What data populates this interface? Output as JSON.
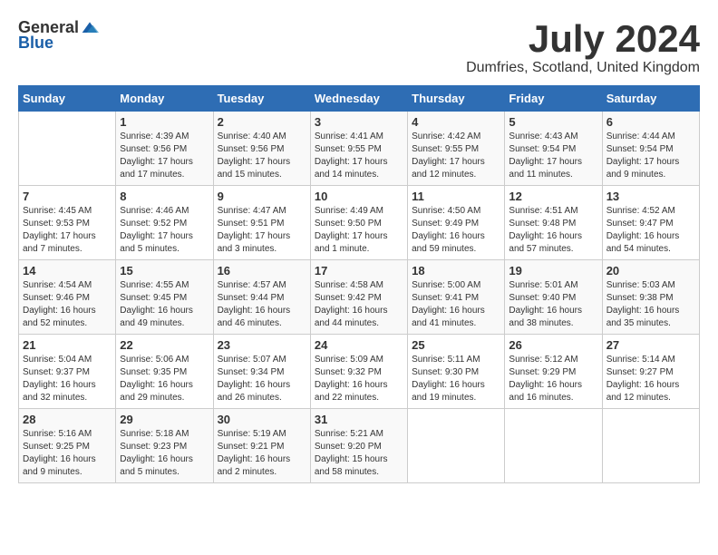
{
  "header": {
    "logo_general": "General",
    "logo_blue": "Blue",
    "title": "July 2024",
    "subtitle": "Dumfries, Scotland, United Kingdom"
  },
  "days_of_week": [
    "Sunday",
    "Monday",
    "Tuesday",
    "Wednesday",
    "Thursday",
    "Friday",
    "Saturday"
  ],
  "weeks": [
    [
      {
        "day": "",
        "info": ""
      },
      {
        "day": "1",
        "info": "Sunrise: 4:39 AM\nSunset: 9:56 PM\nDaylight: 17 hours\nand 17 minutes."
      },
      {
        "day": "2",
        "info": "Sunrise: 4:40 AM\nSunset: 9:56 PM\nDaylight: 17 hours\nand 15 minutes."
      },
      {
        "day": "3",
        "info": "Sunrise: 4:41 AM\nSunset: 9:55 PM\nDaylight: 17 hours\nand 14 minutes."
      },
      {
        "day": "4",
        "info": "Sunrise: 4:42 AM\nSunset: 9:55 PM\nDaylight: 17 hours\nand 12 minutes."
      },
      {
        "day": "5",
        "info": "Sunrise: 4:43 AM\nSunset: 9:54 PM\nDaylight: 17 hours\nand 11 minutes."
      },
      {
        "day": "6",
        "info": "Sunrise: 4:44 AM\nSunset: 9:54 PM\nDaylight: 17 hours\nand 9 minutes."
      }
    ],
    [
      {
        "day": "7",
        "info": "Sunrise: 4:45 AM\nSunset: 9:53 PM\nDaylight: 17 hours\nand 7 minutes."
      },
      {
        "day": "8",
        "info": "Sunrise: 4:46 AM\nSunset: 9:52 PM\nDaylight: 17 hours\nand 5 minutes."
      },
      {
        "day": "9",
        "info": "Sunrise: 4:47 AM\nSunset: 9:51 PM\nDaylight: 17 hours\nand 3 minutes."
      },
      {
        "day": "10",
        "info": "Sunrise: 4:49 AM\nSunset: 9:50 PM\nDaylight: 17 hours\nand 1 minute."
      },
      {
        "day": "11",
        "info": "Sunrise: 4:50 AM\nSunset: 9:49 PM\nDaylight: 16 hours\nand 59 minutes."
      },
      {
        "day": "12",
        "info": "Sunrise: 4:51 AM\nSunset: 9:48 PM\nDaylight: 16 hours\nand 57 minutes."
      },
      {
        "day": "13",
        "info": "Sunrise: 4:52 AM\nSunset: 9:47 PM\nDaylight: 16 hours\nand 54 minutes."
      }
    ],
    [
      {
        "day": "14",
        "info": "Sunrise: 4:54 AM\nSunset: 9:46 PM\nDaylight: 16 hours\nand 52 minutes."
      },
      {
        "day": "15",
        "info": "Sunrise: 4:55 AM\nSunset: 9:45 PM\nDaylight: 16 hours\nand 49 minutes."
      },
      {
        "day": "16",
        "info": "Sunrise: 4:57 AM\nSunset: 9:44 PM\nDaylight: 16 hours\nand 46 minutes."
      },
      {
        "day": "17",
        "info": "Sunrise: 4:58 AM\nSunset: 9:42 PM\nDaylight: 16 hours\nand 44 minutes."
      },
      {
        "day": "18",
        "info": "Sunrise: 5:00 AM\nSunset: 9:41 PM\nDaylight: 16 hours\nand 41 minutes."
      },
      {
        "day": "19",
        "info": "Sunrise: 5:01 AM\nSunset: 9:40 PM\nDaylight: 16 hours\nand 38 minutes."
      },
      {
        "day": "20",
        "info": "Sunrise: 5:03 AM\nSunset: 9:38 PM\nDaylight: 16 hours\nand 35 minutes."
      }
    ],
    [
      {
        "day": "21",
        "info": "Sunrise: 5:04 AM\nSunset: 9:37 PM\nDaylight: 16 hours\nand 32 minutes."
      },
      {
        "day": "22",
        "info": "Sunrise: 5:06 AM\nSunset: 9:35 PM\nDaylight: 16 hours\nand 29 minutes."
      },
      {
        "day": "23",
        "info": "Sunrise: 5:07 AM\nSunset: 9:34 PM\nDaylight: 16 hours\nand 26 minutes."
      },
      {
        "day": "24",
        "info": "Sunrise: 5:09 AM\nSunset: 9:32 PM\nDaylight: 16 hours\nand 22 minutes."
      },
      {
        "day": "25",
        "info": "Sunrise: 5:11 AM\nSunset: 9:30 PM\nDaylight: 16 hours\nand 19 minutes."
      },
      {
        "day": "26",
        "info": "Sunrise: 5:12 AM\nSunset: 9:29 PM\nDaylight: 16 hours\nand 16 minutes."
      },
      {
        "day": "27",
        "info": "Sunrise: 5:14 AM\nSunset: 9:27 PM\nDaylight: 16 hours\nand 12 minutes."
      }
    ],
    [
      {
        "day": "28",
        "info": "Sunrise: 5:16 AM\nSunset: 9:25 PM\nDaylight: 16 hours\nand 9 minutes."
      },
      {
        "day": "29",
        "info": "Sunrise: 5:18 AM\nSunset: 9:23 PM\nDaylight: 16 hours\nand 5 minutes."
      },
      {
        "day": "30",
        "info": "Sunrise: 5:19 AM\nSunset: 9:21 PM\nDaylight: 16 hours\nand 2 minutes."
      },
      {
        "day": "31",
        "info": "Sunrise: 5:21 AM\nSunset: 9:20 PM\nDaylight: 15 hours\nand 58 minutes."
      },
      {
        "day": "",
        "info": ""
      },
      {
        "day": "",
        "info": ""
      },
      {
        "day": "",
        "info": ""
      }
    ]
  ]
}
